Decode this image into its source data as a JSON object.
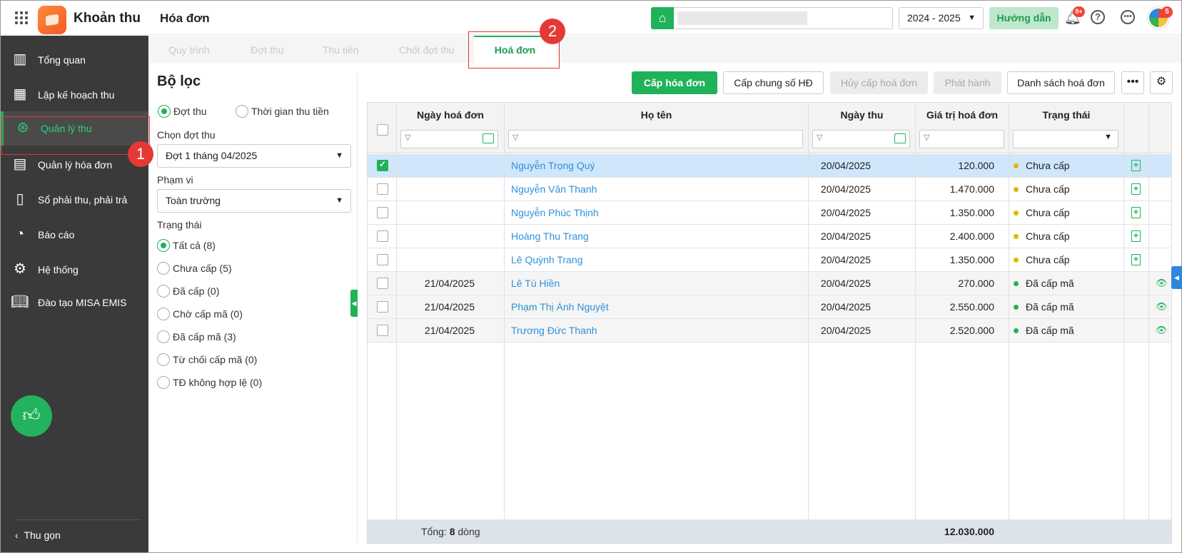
{
  "header": {
    "app_title": "Khoản thu",
    "page_title": "Hóa đơn",
    "school_year": "2024 - 2025",
    "guide_label": "Hướng dẫn",
    "notification_badge": "9+",
    "avatar_badge": "5"
  },
  "sidebar": {
    "items": [
      {
        "label": "Tổng quan",
        "icon": "chart-bars-icon"
      },
      {
        "label": "Lập kế hoạch thu",
        "icon": "calendar-dollar-icon"
      },
      {
        "label": "Quản lý thu",
        "icon": "hand-coin-icon"
      },
      {
        "label": "Quản lý hóa đơn",
        "icon": "invoice-icon"
      },
      {
        "label": "Sổ phải thu, phải trả",
        "icon": "ledger-icon"
      },
      {
        "label": "Báo cáo",
        "icon": "pie-chart-icon"
      },
      {
        "label": "Hệ thống",
        "icon": "gear-icon"
      },
      {
        "label": "Đào tạo MISA EMIS",
        "icon": "book-icon"
      }
    ],
    "active_index": 2,
    "collapse_label": "Thu gọn"
  },
  "annotations": {
    "step1": "1",
    "step2": "2"
  },
  "tabs": [
    {
      "label": "Quy trình"
    },
    {
      "label": "Đợt thu"
    },
    {
      "label": "Thu tiền"
    },
    {
      "label": "Chốt đợt thu"
    },
    {
      "label": "Hoá đơn"
    }
  ],
  "filter": {
    "title": "Bộ lọc",
    "mode_options": [
      "Đợt thu",
      "Thời gian thu tiền"
    ],
    "period_label": "Chọn đợt thu",
    "period_value": "Đợt 1 tháng 04/2025",
    "scope_label": "Phạm vi",
    "scope_value": "Toàn trường",
    "status_label": "Trạng thái",
    "status_options": [
      "Tất cả (8)",
      "Chưa cấp (5)",
      "Đã cấp (0)",
      "Chờ cấp mã (0)",
      "Đã cấp mã (3)",
      "Từ chối cấp mã (0)",
      "TĐ không hợp lệ (0)"
    ]
  },
  "toolbar": {
    "issue": "Cấp hóa đơn",
    "issue_shared": "Cấp chung số HĐ",
    "cancel_issue": "Hủy cấp hoá đơn",
    "publish": "Phát hành",
    "list": "Danh sách hoá đơn"
  },
  "table": {
    "columns": {
      "invoice_date": "Ngày hoá đơn",
      "name": "Họ tên",
      "pay_date": "Ngày thu",
      "amount": "Giá trị hoá đơn",
      "status": "Trạng thái"
    },
    "rows": [
      {
        "invoice_date": "",
        "name": "Nguyễn Trọng Quý",
        "pay_date": "20/04/2025",
        "amount": "120.000",
        "status": "Chưa cấp"
      },
      {
        "invoice_date": "",
        "name": "Nguyễn Văn Thanh",
        "pay_date": "20/04/2025",
        "amount": "1.470.000",
        "status": "Chưa cấp"
      },
      {
        "invoice_date": "",
        "name": "Nguyễn Phúc Thịnh",
        "pay_date": "20/04/2025",
        "amount": "1.350.000",
        "status": "Chưa cấp"
      },
      {
        "invoice_date": "",
        "name": "Hoàng Thu Trang",
        "pay_date": "20/04/2025",
        "amount": "2.400.000",
        "status": "Chưa cấp"
      },
      {
        "invoice_date": "",
        "name": "Lê Quỳnh Trang",
        "pay_date": "20/04/2025",
        "amount": "1.350.000",
        "status": "Chưa cấp"
      },
      {
        "invoice_date": "21/04/2025",
        "name": "Lê Tú Hiền",
        "pay_date": "20/04/2025",
        "amount": "270.000",
        "status": "Đã cấp mã"
      },
      {
        "invoice_date": "21/04/2025",
        "name": "Phạm Thị Ánh Nguyệt",
        "pay_date": "20/04/2025",
        "amount": "2.550.000",
        "status": "Đã cấp mã"
      },
      {
        "invoice_date": "21/04/2025",
        "name": "Trương Đức Thanh",
        "pay_date": "20/04/2025",
        "amount": "2.520.000",
        "status": "Đã cấp mã"
      }
    ],
    "footer_prefix": "Tổng:",
    "footer_count": "8",
    "footer_suffix": "dòng",
    "footer_total": "12.030.000"
  },
  "colors": {
    "accent": "#1fb25a",
    "sidebar": "#3a3a3a",
    "link": "#2f8fd8",
    "pending": "#e8b400",
    "annotation": "#e53935"
  }
}
